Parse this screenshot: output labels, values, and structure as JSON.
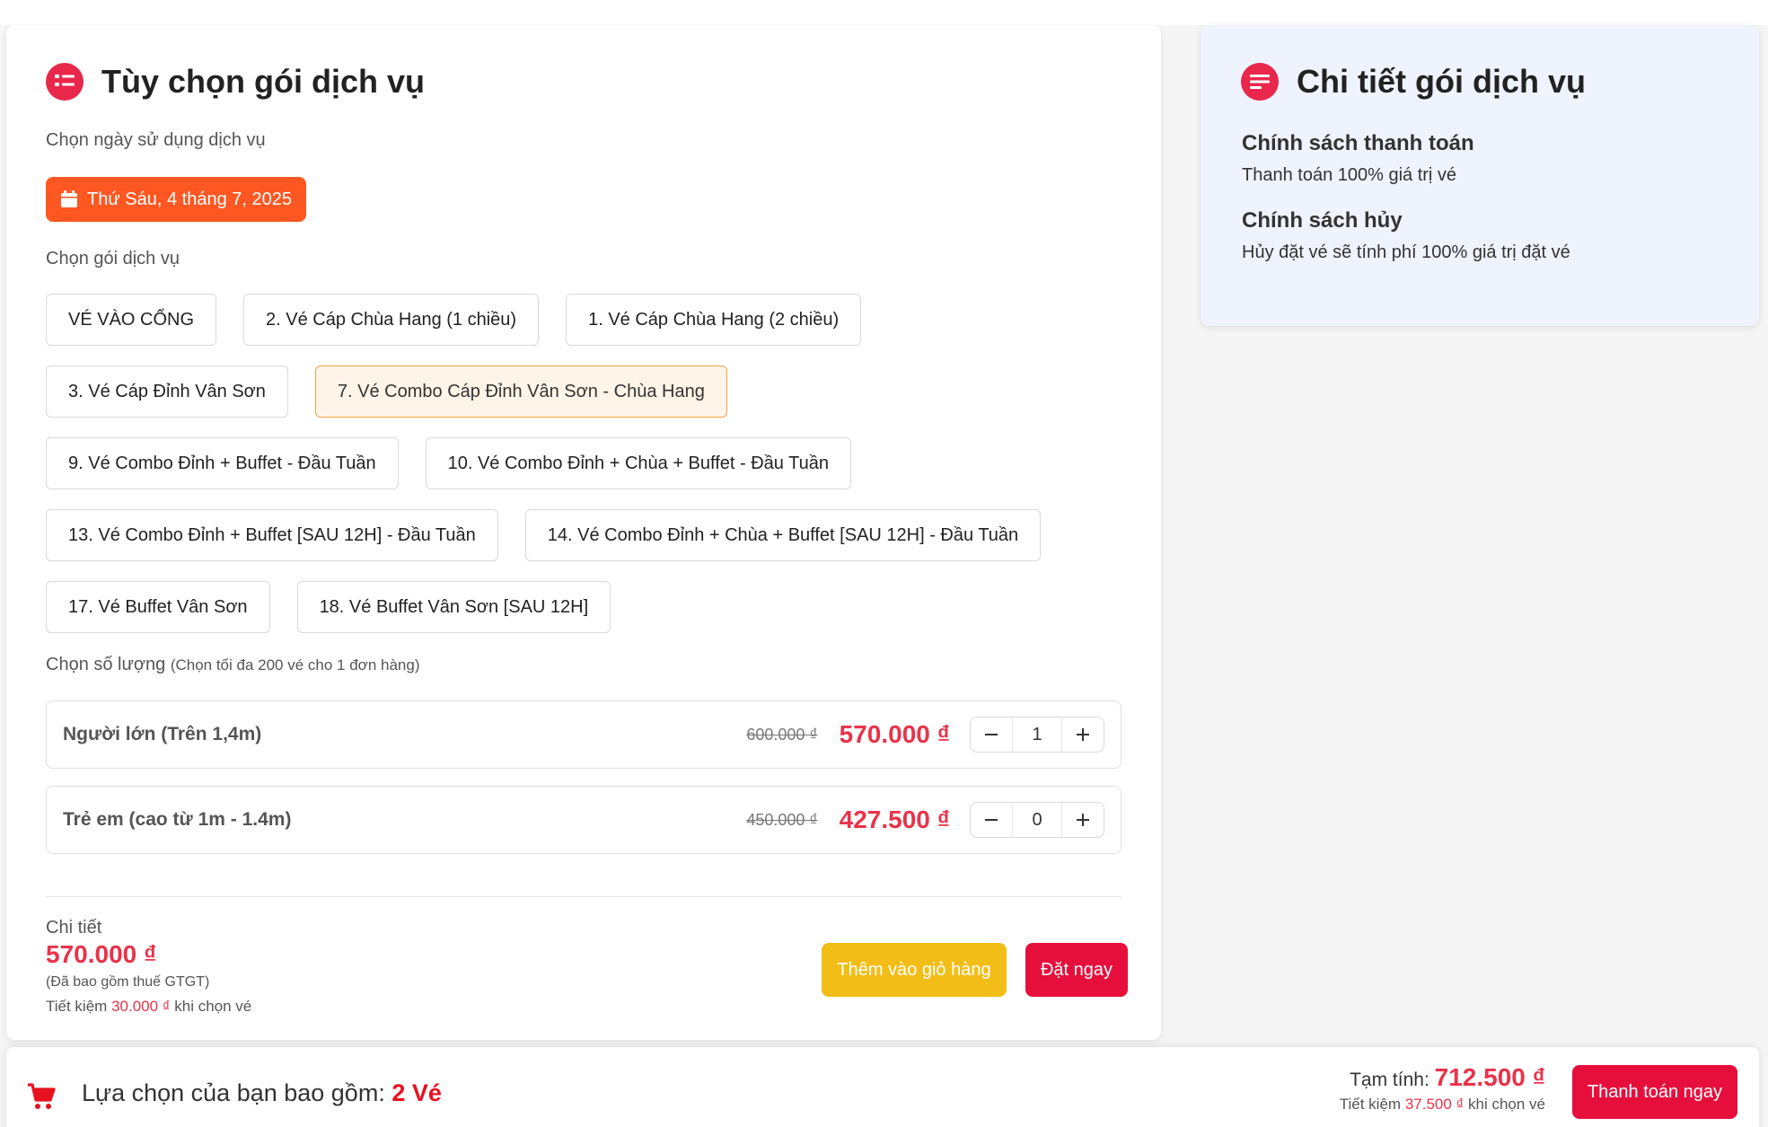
{
  "options_card": {
    "title": "Tùy chọn gói dịch vụ",
    "date_label": "Chọn ngày sử dụng dịch vụ",
    "date_value": "Thứ Sáu, 4 tháng 7, 2025",
    "package_label": "Chọn gói dịch vụ",
    "packages": [
      "VÉ VÀO CỔNG",
      "2. Vé Cáp Chùa Hang (1 chiều)",
      "1. Vé Cáp Chùa Hang (2 chiều)",
      "3. Vé Cáp Đỉnh Vân Sơn",
      "7. Vé Combo Cáp Đỉnh Vân Sơn - Chùa Hang",
      "9. Vé Combo Đỉnh + Buffet - Đầu Tuần",
      "10. Vé Combo Đỉnh + Chùa + Buffet - Đầu Tuần",
      "13. Vé Combo Đỉnh + Buffet [SAU 12H] - Đầu Tuần",
      "14. Vé Combo Đỉnh + Chùa + Buffet [SAU 12H] - Đầu Tuần",
      "17. Vé Buffet Vân Sơn",
      "18. Vé Buffet Vân Sơn [SAU 12H]"
    ],
    "selected_package": "7. Vé Combo Cáp Đỉnh Vân Sơn - Chùa Hang",
    "quantity_label": "Chọn số lượng",
    "quantity_hint": "(Chọn tối đa 200 vé cho 1 đơn hàng)",
    "tickets": [
      {
        "label": "Người lớn (Trên 1,4m)",
        "old_price": "600.000 ₫",
        "price": "570.000 ₫",
        "qty": "1"
      },
      {
        "label": "Trẻ em (cao từ 1m - 1.4m)",
        "old_price": "450.000 ₫",
        "price": "427.500 ₫",
        "qty": "0"
      }
    ],
    "detail_label": "Chi tiết",
    "detail_total": "570.000 ₫",
    "vat_note": "(Đã bao gồm thuế GTGT)",
    "save_prefix": "Tiết kiệm",
    "save_amount": "30.000 ₫",
    "save_suffix": "khi chọn vé",
    "add_to_cart": "Thêm vào giỏ hàng",
    "book_now": "Đặt ngay"
  },
  "details_card": {
    "title": "Chi tiết gói dịch vụ",
    "payment_policy_title": "Chính sách thanh toán",
    "payment_policy_text": "Thanh toán 100% giá trị vé",
    "cancel_policy_title": "Chính sách hủy",
    "cancel_policy_text": "Hủy đặt vé sẽ tính phí 100% giá trị đặt vé"
  },
  "bottom_bar": {
    "selection_prefix": "Lựa chọn của bạn bao gồm:",
    "selection_count": "2 Vé",
    "subtotal_label": "Tạm tính:",
    "subtotal_value": "712.500 ₫",
    "save_prefix": "Tiết kiệm",
    "save_amount": "37.500 ₫",
    "save_suffix": "khi chọn vé",
    "pay_button": "Thanh toán ngay"
  },
  "colors": {
    "accent_red": "#e8334a",
    "date_orange": "#ff5722",
    "cart_yellow": "#f2bd16",
    "button_red": "#e60f3c",
    "selected_bg": "#fff4e8",
    "details_bg": "#eef3fd"
  },
  "icons": [
    "list-icon",
    "calendar-icon",
    "minus-icon",
    "plus-icon",
    "notes-icon",
    "cart-icon"
  ]
}
